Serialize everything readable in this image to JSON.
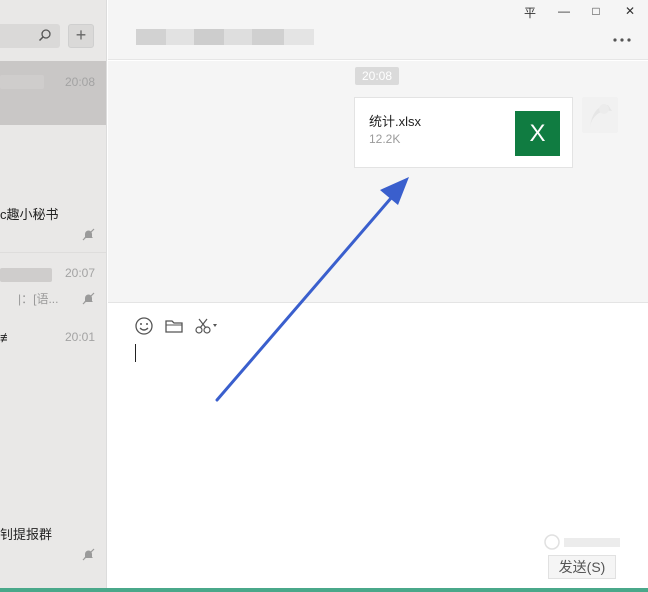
{
  "sidebar": {
    "add_label": "+",
    "chats": [
      {
        "time": "20:08"
      },
      {
        "title": "c趣小秘书"
      },
      {
        "time": "20:07",
        "preview": "|：[语..."
      },
      {
        "title": "≢",
        "time": "20:01"
      },
      {
        "title": "钊提报群"
      }
    ]
  },
  "window": {
    "controls": [
      "平",
      "—",
      "□",
      "✕"
    ],
    "more_label": "⋮"
  },
  "conversation": {
    "time_label": "20:08",
    "file": {
      "name": "统计.xlsx",
      "size": "12.2K",
      "icon_letter": "X",
      "icon_color": "#107c41"
    }
  },
  "composer": {
    "send_label": "发送(S)"
  },
  "annotation": {
    "arrow_color": "#3a5fcd"
  }
}
